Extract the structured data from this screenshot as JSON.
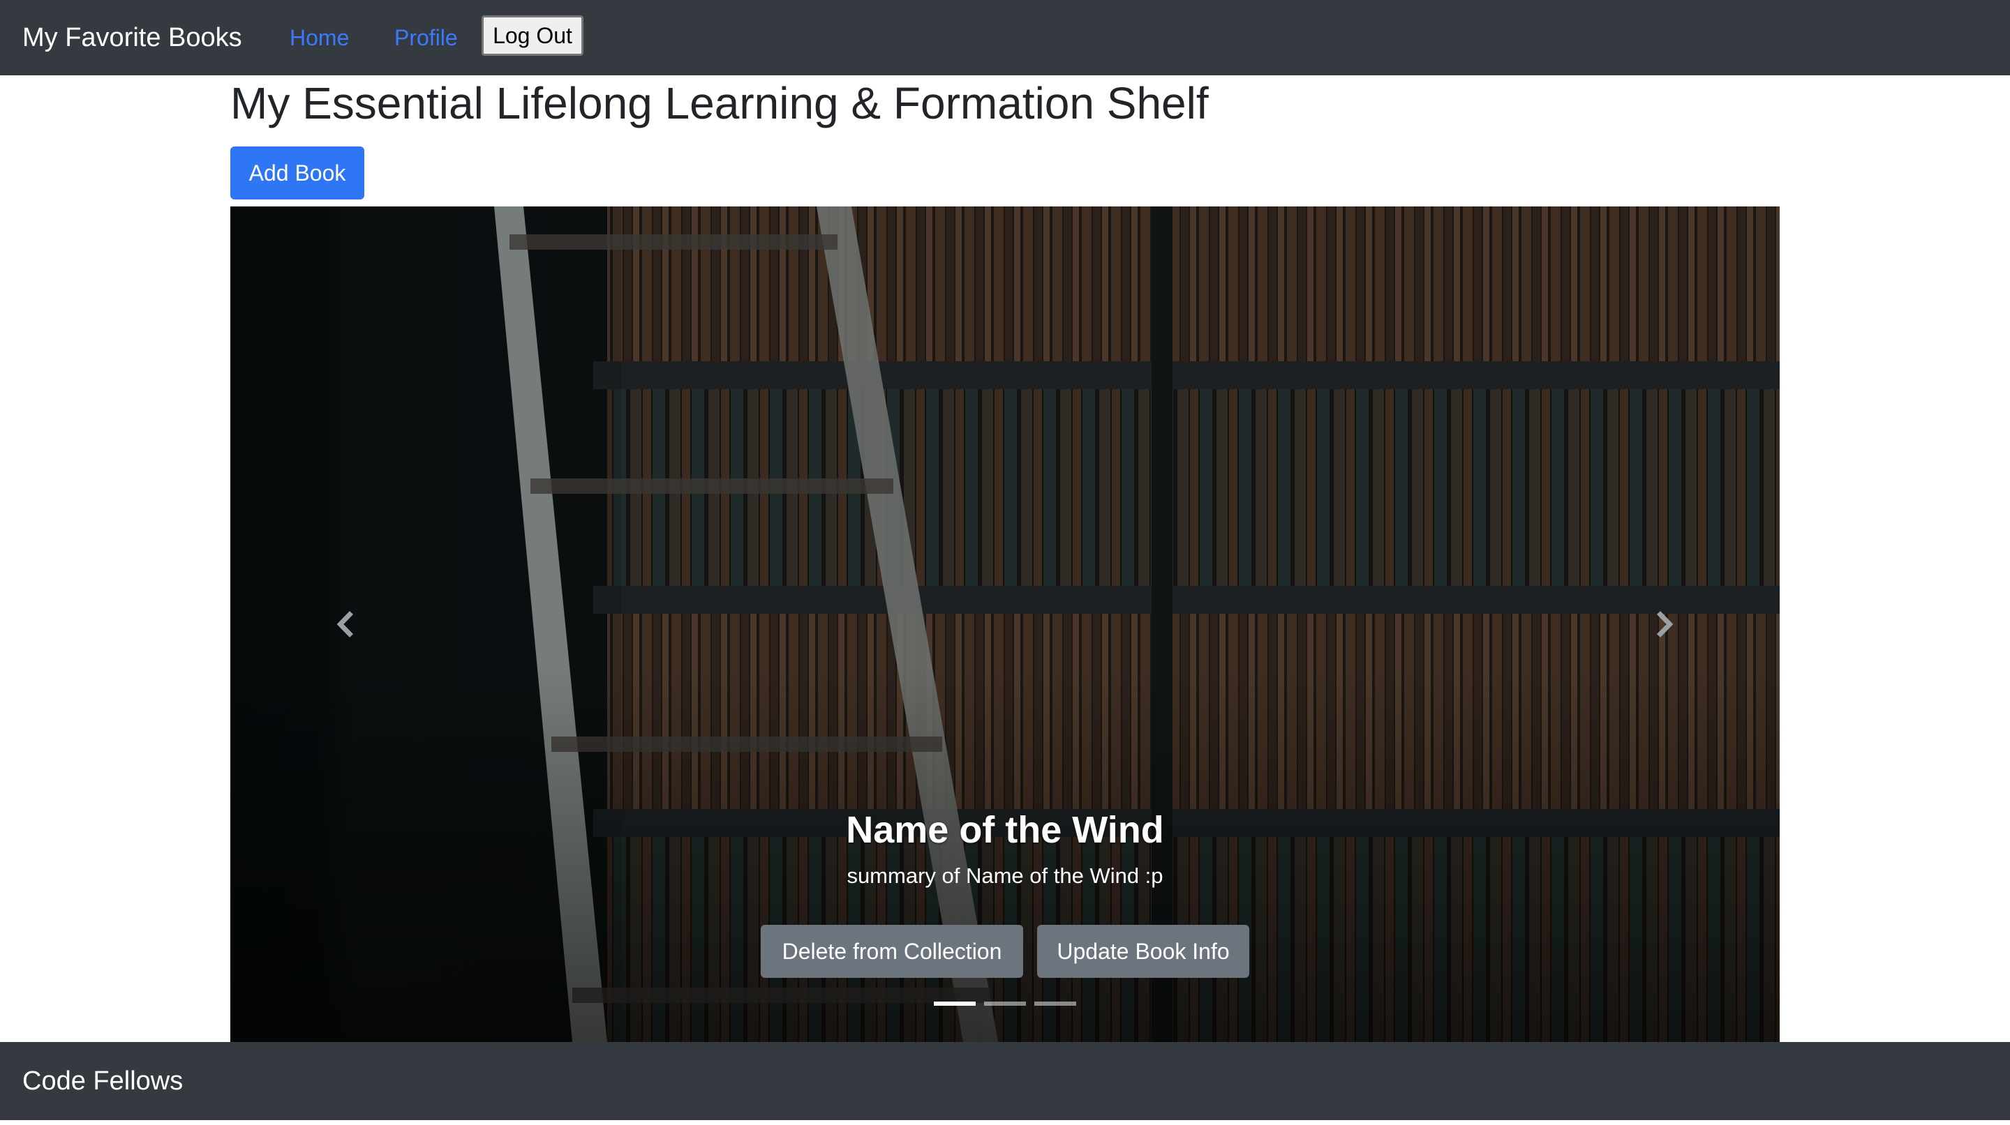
{
  "navbar": {
    "brand": "My Favorite Books",
    "links": [
      "Home",
      "Profile"
    ],
    "logout_label": "Log Out"
  },
  "page": {
    "title": "My Essential Lifelong Learning & Formation Shelf",
    "add_book_label": "Add Book"
  },
  "carousel": {
    "active_index": 0,
    "slide_count": 3,
    "current": {
      "title": "Name of the Wind",
      "summary": "summary of Name of the Wind :p"
    },
    "delete_label": "Delete from Collection",
    "update_label": "Update Book Info",
    "prev_icon": "chevron-left-icon",
    "next_icon": "chevron-right-icon"
  },
  "footer": {
    "text": "Code Fellows"
  },
  "colors": {
    "navbar_bg": "#343a40",
    "link": "#3a7bfd",
    "primary": "#2f76f4",
    "secondary": "#6c757d"
  }
}
